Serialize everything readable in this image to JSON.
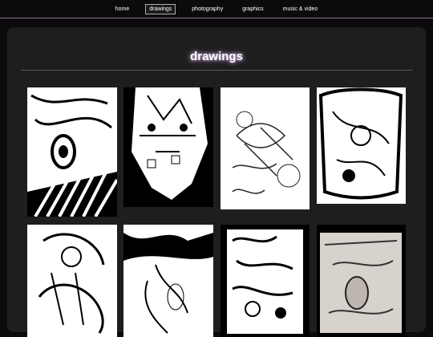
{
  "nav": {
    "items": [
      {
        "label": "home",
        "active": false
      },
      {
        "label": "drawings",
        "active": true
      },
      {
        "label": "photography",
        "active": false
      },
      {
        "label": "graphics",
        "active": false
      },
      {
        "label": "music & video",
        "active": false
      }
    ]
  },
  "page": {
    "title": "drawings"
  },
  "colors": {
    "background": "#0b0b0b",
    "panel": "#1e1e1e",
    "nav_border": "#8a6f8e",
    "title_glow": "#d6b6e6"
  }
}
